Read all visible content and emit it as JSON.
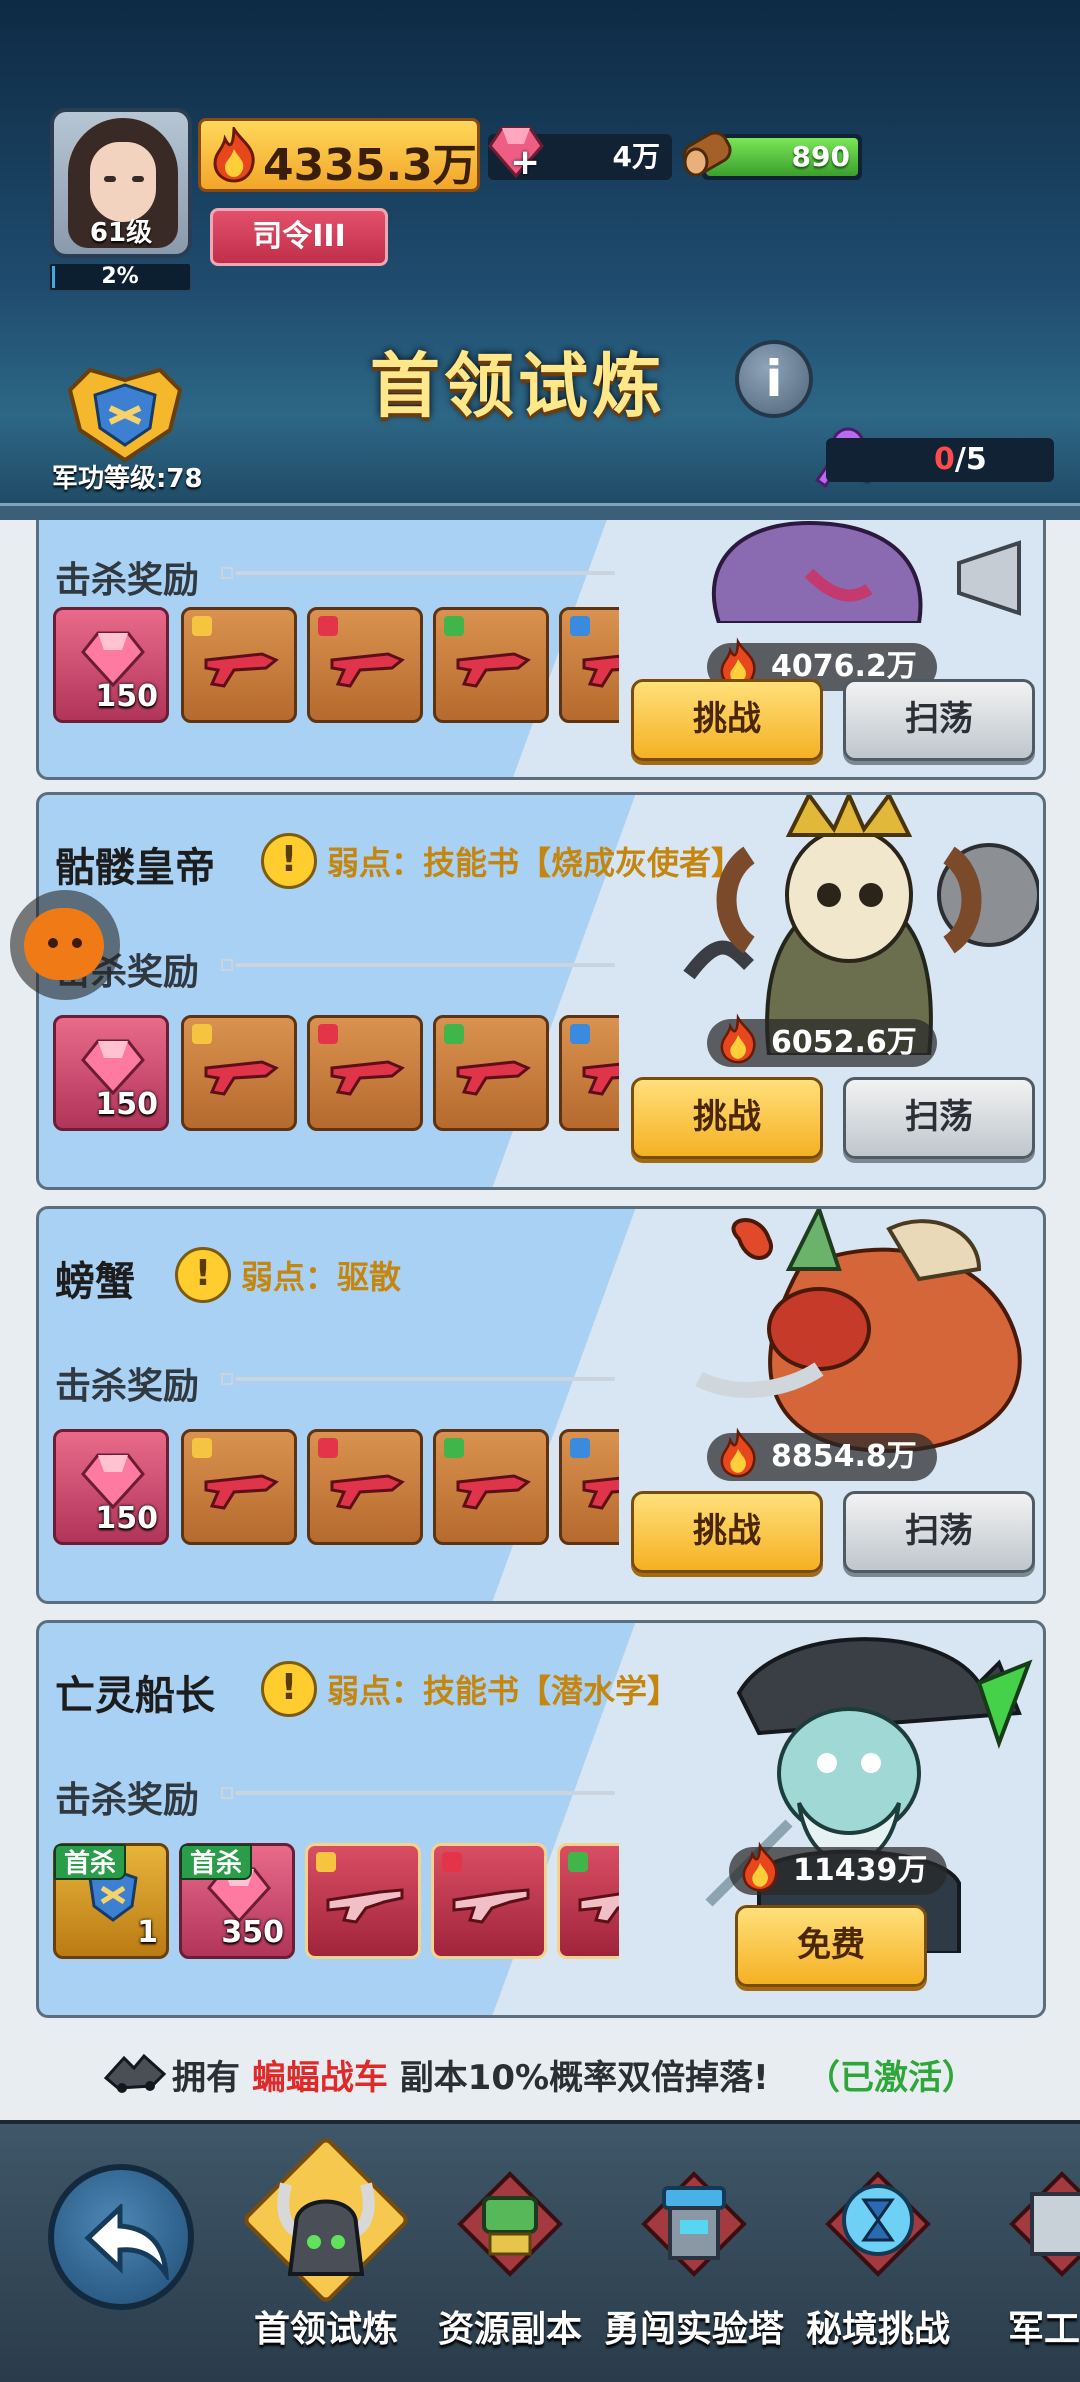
{
  "header": {
    "player_level": "61级",
    "xp_percent": "2%",
    "combat_power": "4335.3万",
    "rank_title": "司令III",
    "gems": "4万",
    "wood": "890",
    "page_title": "首领试炼",
    "military_level_label": "军功等级:78",
    "keys_current": "0",
    "keys_max": "/5"
  },
  "reward_label": "击杀奖励",
  "bosses": [
    {
      "name": "",
      "weakness": "",
      "power": "4076.2万",
      "reward_gem_count": "150",
      "challenge_label": "挑战",
      "sweep_label": "扫荡"
    },
    {
      "name": "骷髅皇帝",
      "weakness": "弱点：技能书【烧成灰使者】",
      "power": "6052.6万",
      "reward_gem_count": "150",
      "challenge_label": "挑战",
      "sweep_label": "扫荡"
    },
    {
      "name": "螃蟹",
      "weakness": "弱点：驱散",
      "power": "8854.8万",
      "reward_gem_count": "150",
      "challenge_label": "挑战",
      "sweep_label": "扫荡"
    },
    {
      "name": "亡灵船长",
      "weakness": "弱点：技能书【潜水学】",
      "power": "11439万",
      "first_kill_tag": "首杀",
      "first_kill_badge_count": "1",
      "first_kill_gem_count": "350",
      "free_label": "免费"
    }
  ],
  "bonus": {
    "prefix": "拥有",
    "vehicle": "蝙蝠战车",
    "suffix": "副本10%概率双倍掉落!",
    "status": "（已激活）"
  },
  "nav": {
    "items": [
      "首领试炼",
      "资源副本",
      "勇闯实验塔",
      "秘境挑战",
      "军工厂"
    ],
    "active_index": 0
  },
  "colors": {
    "accent_yellow": "#f5b124",
    "card_blue": "#a8d1f4",
    "warning_red": "#ff4b4b",
    "activated_green": "#2ea63a"
  }
}
